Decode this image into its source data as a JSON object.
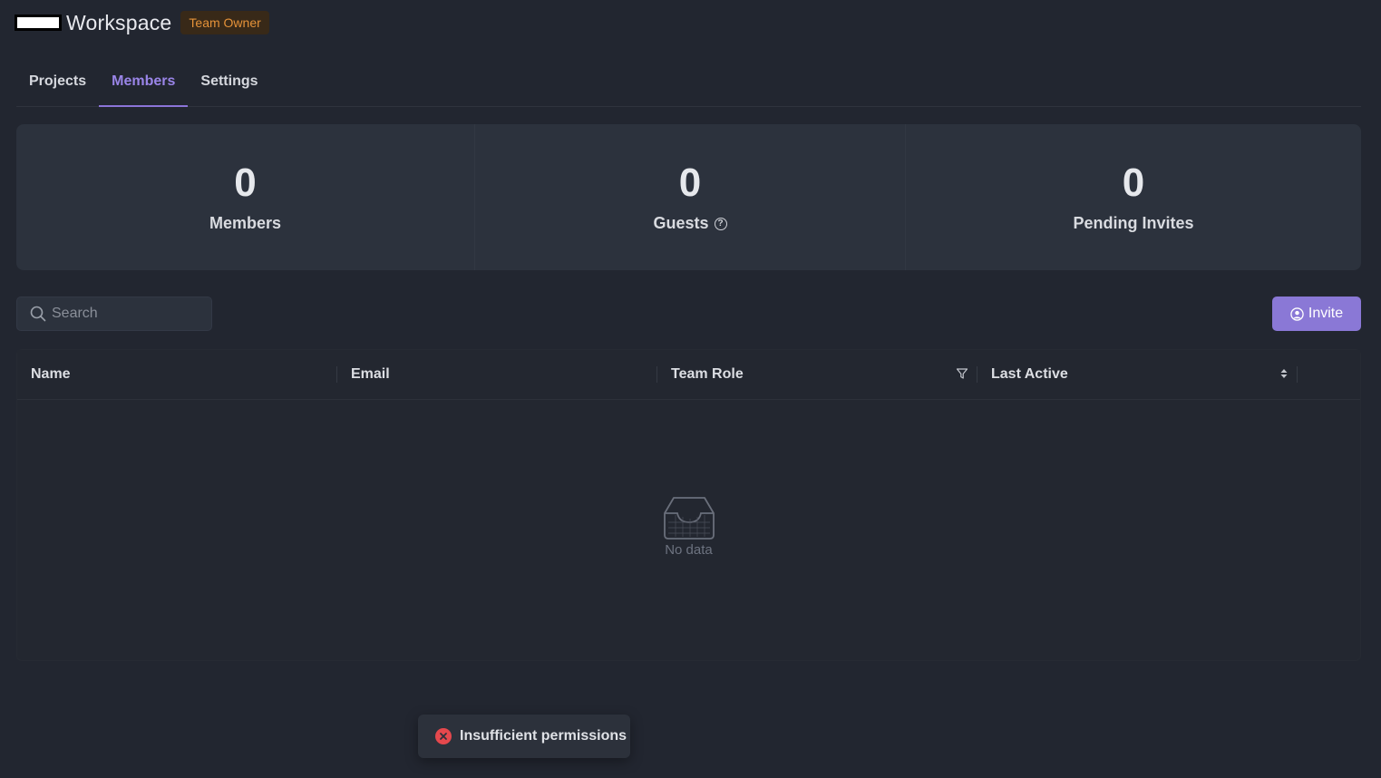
{
  "header": {
    "title": "Workspace",
    "badge": "Team Owner"
  },
  "tabs": [
    {
      "label": "Projects",
      "active": false
    },
    {
      "label": "Members",
      "active": true
    },
    {
      "label": "Settings",
      "active": false
    }
  ],
  "stats": [
    {
      "value": "0",
      "label": "Members"
    },
    {
      "value": "0",
      "label": "Guests"
    },
    {
      "value": "0",
      "label": "Pending Invites"
    }
  ],
  "search": {
    "placeholder": "Search",
    "value": ""
  },
  "invite": {
    "label": "Invite",
    "icon": "user-circle-icon"
  },
  "table": {
    "columns": [
      "Name",
      "Email",
      "Team Role",
      "Last Active"
    ],
    "rows": [],
    "empty_text": "No data"
  },
  "toast": {
    "text": "Insufficient permissions",
    "icon": "error-circle-icon",
    "color": "#e5484d"
  },
  "colors": {
    "accent": "#8a78d6",
    "badge_text": "#e59239",
    "background": "#222630"
  }
}
